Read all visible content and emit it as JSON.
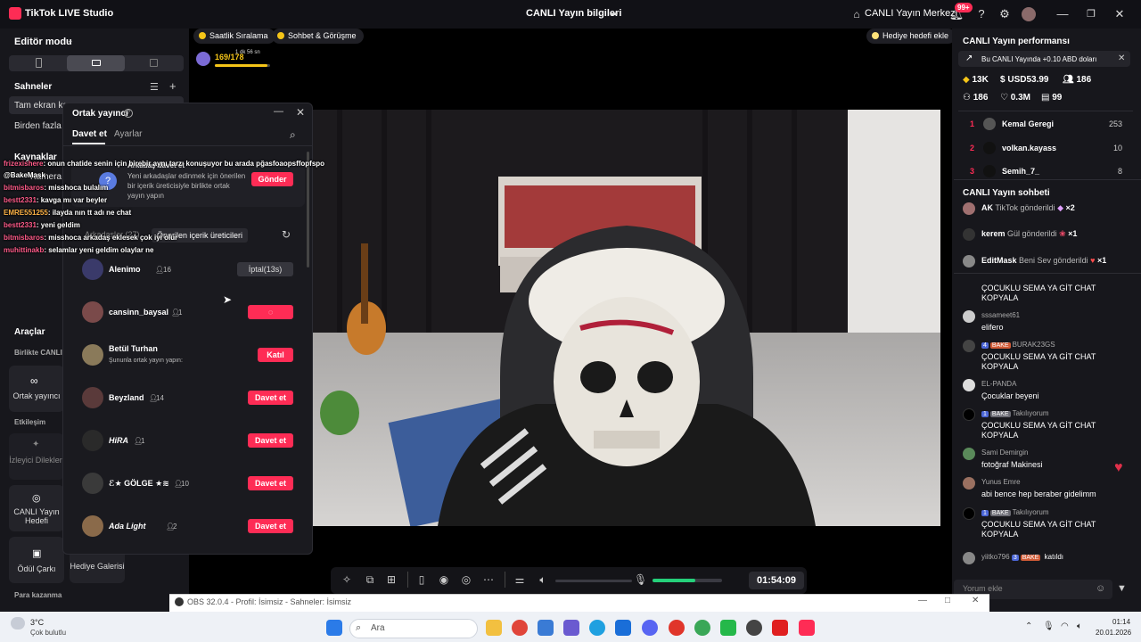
{
  "titlebar": {
    "app_name": "TikTok LIVE Studio",
    "center_title": "CANLI Yayın bilgileri",
    "live_center": "CANLI Yayın Merkezi",
    "notif_badge": "99+"
  },
  "left_panel": {
    "editor_mode": "Editör modu",
    "scenes_title": "Sahneler",
    "scene_items": [
      "Tam ekran kamera",
      "Birden fazla v"
    ],
    "sources_title": "Kaynaklar",
    "source_camera": "Kamera",
    "tools_title": "Araçlar",
    "multi_guest": "Birlikte CANLI",
    "co_host": "Ortak yayıncı",
    "engagement": "Etkileşim",
    "viewer_wishes": "İzleyici Dilekleri",
    "live_goal": "CANLI Yayın Hedefi",
    "reward_wheel": "Ödül Çarkı",
    "gift_goal": "Hediye Galerisi",
    "monetize": "Para kazanma"
  },
  "top_pills": {
    "hourly_rank": "Saatlik Sıralama",
    "chat_meet": "Sohbet & Görüşme",
    "add_gift_goal": "Hediye hedefi ekle",
    "goal_progress": "169/178",
    "goal_timer": "1 dk 56 sn",
    "goal_fraction": 0.95
  },
  "cohost_modal": {
    "title": "Ortak yayıncı",
    "tab_invite": "Davet et",
    "tab_settings": "Ayarlar",
    "invite_card_title": "Arkadaş davet et",
    "invite_card_text": "Yeni arkadaşlar edinmek için önerilen bir içerik üreticisiyle birlikte ortak yayın yapın",
    "send_button": "Gönder",
    "friends_label": "Arkadaşlar (27)",
    "recommended_tag": "Önerilen içerik üreticileri",
    "rows": [
      {
        "name": "Alenimo",
        "count": "16",
        "action": "İptal(13s)",
        "style": "gray"
      },
      {
        "name": "cansinn_baysal",
        "count": "1",
        "action": "",
        "style": "loading"
      },
      {
        "name": "Betül Turhan",
        "count": "",
        "sub": "Şununla ortak yayın yapın:",
        "action": "Katıl",
        "style": "red"
      },
      {
        "name": "Beyzland",
        "count": "14",
        "action": "Davet et",
        "style": "red"
      },
      {
        "name": "HiRA",
        "count": "1",
        "action": "Davet et",
        "style": "red"
      },
      {
        "name": "ℰ★ GÖLGE ★≋",
        "count": "10",
        "action": "Davet et",
        "style": "red"
      },
      {
        "name": "Ada Light",
        "count": "2",
        "action": "Davet et",
        "style": "red"
      }
    ]
  },
  "chat_overlay": [
    {
      "user": "frizexishere",
      "msg": ": onun chatide senin için birebir aynı tarzı konuşuyor bu arada pğasfoaopsffopfspo"
    },
    {
      "user": "@BakeMask",
      "msg": ""
    },
    {
      "user": "bitmisbaros",
      "msg": ": misshoca bulalım"
    },
    {
      "user": "bestt2331",
      "msg": ": kavga mı var beyler"
    },
    {
      "user": "EMRE551255",
      "msg": ": ilayda nın tt adı ne chat"
    },
    {
      "user": "bestt2331",
      "msg": ": yeni geldim"
    },
    {
      "user": "bitmisbaros",
      "msg": ": misshoca arkadaş eklesek çok iyi olur"
    },
    {
      "user": "muhittinakb",
      "msg": ": selamlar yeni geldim olaylar ne"
    }
  ],
  "controls": {
    "timer": "01:54:09",
    "volume_fraction": 0.0,
    "mic_fraction": 0.62
  },
  "right_panel": {
    "perf_title": "CANLI Yayın performansı",
    "promo_text": "Bu CANLI Yayında +0.10 ABD doları",
    "stats": {
      "diamonds": "13K",
      "usd": "USD53.99",
      "viewers": "186",
      "followers": "186",
      "likes": "0.3M",
      "rank": "99"
    },
    "ranking": [
      {
        "rank": "1",
        "name": "Kemal Geregi",
        "score": "253"
      },
      {
        "rank": "2",
        "name": "volkan.kayass",
        "score": "10"
      },
      {
        "rank": "3",
        "name": "Semih_7_",
        "score": "8"
      }
    ],
    "chat_title": "CANLI Yayın sohbeti",
    "gifts": [
      {
        "user": "AK",
        "text": "TikTok gönderildi",
        "mult": "×2"
      },
      {
        "user": "kerem",
        "text": "Gül gönderildi",
        "mult": "×1"
      },
      {
        "user": "EditMask",
        "text": "Beni Sev gönderildi",
        "mult": "×1"
      }
    ],
    "chat": [
      {
        "name": "",
        "msg": "ÇOCUKLU SEMA YA GİT CHAT KOPYALA"
      },
      {
        "name": "sssameet61",
        "msg": "elifero"
      },
      {
        "name": "BURAK23GS",
        "lvl": "4",
        "fan": "BAKE",
        "msg": "ÇOCUKLU SEMA YA GİT CHAT KOPYALA"
      },
      {
        "name": "EL-PANDA",
        "msg": "Çocuklar beyeni"
      },
      {
        "name": "Takılıyorum",
        "lvl": "1",
        "fan": "BAKE",
        "msg": "ÇOCUKLU SEMA YA GİT CHAT KOPYALA"
      },
      {
        "name": "Sami Demirgin",
        "msg": "fotoğraf Makinesi"
      },
      {
        "name": "Yunus Emre",
        "msg": "abi bence hep beraber gidelimm"
      },
      {
        "name": "Takılıyorum",
        "lvl": "1",
        "fan": "BAKE",
        "msg": "ÇOCUKLU SEMA YA GİT CHAT KOPYALA"
      },
      {
        "name": "yiitko796",
        "lvl": "3",
        "fan": "BAKE",
        "msg": "katıldı"
      }
    ],
    "comment_placeholder": "Yorum ekle"
  },
  "obs_bar": {
    "text": "OBS 32.0.4 - Profil: İsimsiz - Sahneler: İsimsiz"
  },
  "taskbar": {
    "temp": "3°C",
    "weather": "Çok bulutlu",
    "search": "Ara",
    "time": "01:14",
    "date": "20.01.2026"
  },
  "colors": {
    "accent": "#fe2c55",
    "green": "#25d07a",
    "panel": "#17171c"
  }
}
